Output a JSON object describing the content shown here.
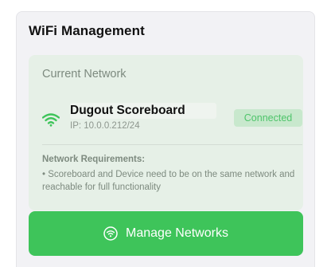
{
  "card": {
    "title": "WiFi Management"
  },
  "network": {
    "heading": "Current Network",
    "name": "Dugout Scoreboard",
    "ip": "IP: 10.0.0.212/24",
    "status": "Connected",
    "icon": "wifi-icon",
    "requirements_heading": "Network Requirements:",
    "requirements_text": "• Scoreboard and Device need to be on the same network and reachable for full functionality"
  },
  "actions": {
    "manage_label": "Manage Networks",
    "manage_icon": "wifi-circle-icon"
  },
  "colors": {
    "accent_green": "#3ec45a",
    "panel_background": "#e6f0e7",
    "status_text": "#4ec46a"
  }
}
